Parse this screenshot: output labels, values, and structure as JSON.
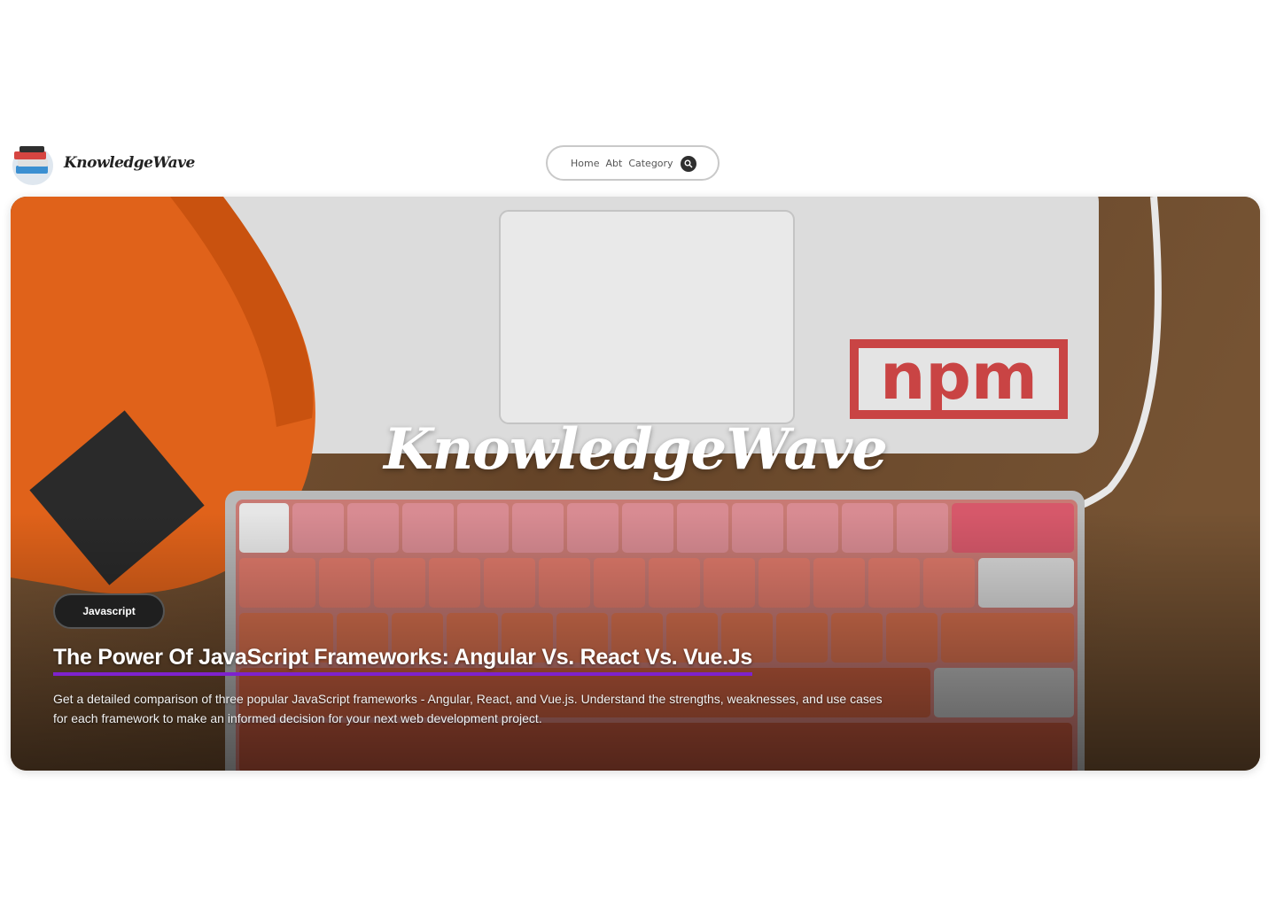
{
  "header": {
    "logo_text": "KnowledgeWave",
    "nav": {
      "items": [
        "Home",
        "Abt",
        "Category"
      ],
      "search_icon": "search-icon"
    }
  },
  "hero": {
    "brand_title": "KnowledgeWave",
    "tag": "Javascript",
    "article_title": "The Power Of JavaScript Frameworks: Angular Vs. React Vs. Vue.Js",
    "article_desc": "Get a detailed comparison of three popular JavaScript frameworks - Angular, React, and Vue.js. Understand the strengths, weaknesses, and use cases for each framework to make an informed decision for your next web development project.",
    "image_sticker_text": "npm",
    "colors": {
      "accent_underline": "#7e22ce",
      "tag_bg": "#1f1f1f"
    }
  }
}
